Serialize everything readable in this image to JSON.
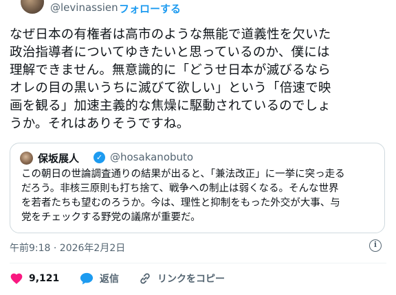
{
  "author": {
    "handle": "@levinassien",
    "separator": "·",
    "follow_label": "フォローする"
  },
  "tweet": {
    "lines": [
      "なぜ日本の有権者は高市のような無能で道義性を欠いた",
      "政治指導者についてゆきたいと思っているのか、僕には",
      "理解できません。無意識的に「どうせ日本が滅びるなら",
      "オレの目の黒いうちに滅びて欲しい」という「倍速で映",
      "画を観る」加速主義的な焦燥に駆動されているのでしょ",
      "うか。それはありそうですね。"
    ]
  },
  "quote": {
    "name": "保坂展人",
    "verified_icon": "verified-badge",
    "handle": "@hosakanobuto",
    "lines": [
      "この朝日の世論調査通りの結果が出ると、「兼法改正」に一挙に突っ走る",
      "だろう。非核三原則も打ち捨て、戦争への制止は弱くなる。そんな世界",
      "を若者たちも望むのろうか。今は、理性と抑制をもった外交が大事、与",
      "党をチェックする野党の議席が重要だ。"
    ]
  },
  "meta": {
    "timestamp": "午前9:18 · 2026年2月2日"
  },
  "actions": {
    "like_count": "9,121",
    "reply_label": "返信",
    "copy_link_label": "リンクをコピー"
  },
  "colors": {
    "accent": "#1d9bf0",
    "like": "#f91880",
    "muted": "#536471",
    "text": "#0f1419",
    "border": "#cfd9de"
  }
}
